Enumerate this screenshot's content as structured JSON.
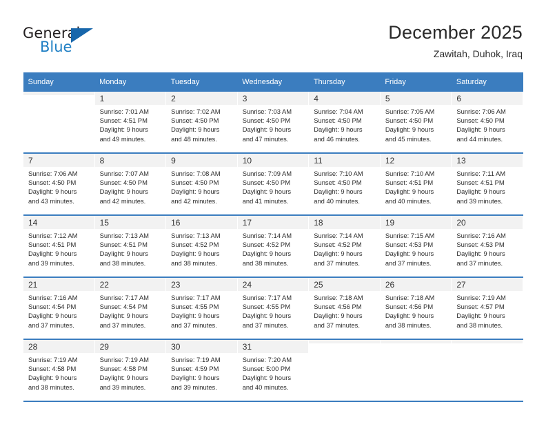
{
  "brand": {
    "name_part1": "General",
    "name_part2": "Blue",
    "triangle_color": "#1766ab",
    "blue_color": "#1f7fc4"
  },
  "header": {
    "title": "December 2025",
    "location": "Zawitah, Duhok, Iraq"
  },
  "theme": {
    "header_row_bg": "#3b7dbf",
    "band_bg": "#f2f2f2",
    "text": "#2b2b2b"
  },
  "calendar": {
    "weekday_headers": [
      "Sunday",
      "Monday",
      "Tuesday",
      "Wednesday",
      "Thursday",
      "Friday",
      "Saturday"
    ],
    "weeks": [
      [
        {
          "day": "",
          "empty": true,
          "sunrise": "",
          "sunset": "",
          "daylight_line1": "",
          "daylight_line2": ""
        },
        {
          "day": "1",
          "sunrise": "Sunrise: 7:01 AM",
          "sunset": "Sunset: 4:51 PM",
          "daylight_line1": "Daylight: 9 hours",
          "daylight_line2": "and 49 minutes."
        },
        {
          "day": "2",
          "sunrise": "Sunrise: 7:02 AM",
          "sunset": "Sunset: 4:50 PM",
          "daylight_line1": "Daylight: 9 hours",
          "daylight_line2": "and 48 minutes."
        },
        {
          "day": "3",
          "sunrise": "Sunrise: 7:03 AM",
          "sunset": "Sunset: 4:50 PM",
          "daylight_line1": "Daylight: 9 hours",
          "daylight_line2": "and 47 minutes."
        },
        {
          "day": "4",
          "sunrise": "Sunrise: 7:04 AM",
          "sunset": "Sunset: 4:50 PM",
          "daylight_line1": "Daylight: 9 hours",
          "daylight_line2": "and 46 minutes."
        },
        {
          "day": "5",
          "sunrise": "Sunrise: 7:05 AM",
          "sunset": "Sunset: 4:50 PM",
          "daylight_line1": "Daylight: 9 hours",
          "daylight_line2": "and 45 minutes."
        },
        {
          "day": "6",
          "sunrise": "Sunrise: 7:06 AM",
          "sunset": "Sunset: 4:50 PM",
          "daylight_line1": "Daylight: 9 hours",
          "daylight_line2": "and 44 minutes."
        }
      ],
      [
        {
          "day": "7",
          "sunrise": "Sunrise: 7:06 AM",
          "sunset": "Sunset: 4:50 PM",
          "daylight_line1": "Daylight: 9 hours",
          "daylight_line2": "and 43 minutes."
        },
        {
          "day": "8",
          "sunrise": "Sunrise: 7:07 AM",
          "sunset": "Sunset: 4:50 PM",
          "daylight_line1": "Daylight: 9 hours",
          "daylight_line2": "and 42 minutes."
        },
        {
          "day": "9",
          "sunrise": "Sunrise: 7:08 AM",
          "sunset": "Sunset: 4:50 PM",
          "daylight_line1": "Daylight: 9 hours",
          "daylight_line2": "and 42 minutes."
        },
        {
          "day": "10",
          "sunrise": "Sunrise: 7:09 AM",
          "sunset": "Sunset: 4:50 PM",
          "daylight_line1": "Daylight: 9 hours",
          "daylight_line2": "and 41 minutes."
        },
        {
          "day": "11",
          "sunrise": "Sunrise: 7:10 AM",
          "sunset": "Sunset: 4:50 PM",
          "daylight_line1": "Daylight: 9 hours",
          "daylight_line2": "and 40 minutes."
        },
        {
          "day": "12",
          "sunrise": "Sunrise: 7:10 AM",
          "sunset": "Sunset: 4:51 PM",
          "daylight_line1": "Daylight: 9 hours",
          "daylight_line2": "and 40 minutes."
        },
        {
          "day": "13",
          "sunrise": "Sunrise: 7:11 AM",
          "sunset": "Sunset: 4:51 PM",
          "daylight_line1": "Daylight: 9 hours",
          "daylight_line2": "and 39 minutes."
        }
      ],
      [
        {
          "day": "14",
          "sunrise": "Sunrise: 7:12 AM",
          "sunset": "Sunset: 4:51 PM",
          "daylight_line1": "Daylight: 9 hours",
          "daylight_line2": "and 39 minutes."
        },
        {
          "day": "15",
          "sunrise": "Sunrise: 7:13 AM",
          "sunset": "Sunset: 4:51 PM",
          "daylight_line1": "Daylight: 9 hours",
          "daylight_line2": "and 38 minutes."
        },
        {
          "day": "16",
          "sunrise": "Sunrise: 7:13 AM",
          "sunset": "Sunset: 4:52 PM",
          "daylight_line1": "Daylight: 9 hours",
          "daylight_line2": "and 38 minutes."
        },
        {
          "day": "17",
          "sunrise": "Sunrise: 7:14 AM",
          "sunset": "Sunset: 4:52 PM",
          "daylight_line1": "Daylight: 9 hours",
          "daylight_line2": "and 38 minutes."
        },
        {
          "day": "18",
          "sunrise": "Sunrise: 7:14 AM",
          "sunset": "Sunset: 4:52 PM",
          "daylight_line1": "Daylight: 9 hours",
          "daylight_line2": "and 37 minutes."
        },
        {
          "day": "19",
          "sunrise": "Sunrise: 7:15 AM",
          "sunset": "Sunset: 4:53 PM",
          "daylight_line1": "Daylight: 9 hours",
          "daylight_line2": "and 37 minutes."
        },
        {
          "day": "20",
          "sunrise": "Sunrise: 7:16 AM",
          "sunset": "Sunset: 4:53 PM",
          "daylight_line1": "Daylight: 9 hours",
          "daylight_line2": "and 37 minutes."
        }
      ],
      [
        {
          "day": "21",
          "sunrise": "Sunrise: 7:16 AM",
          "sunset": "Sunset: 4:54 PM",
          "daylight_line1": "Daylight: 9 hours",
          "daylight_line2": "and 37 minutes."
        },
        {
          "day": "22",
          "sunrise": "Sunrise: 7:17 AM",
          "sunset": "Sunset: 4:54 PM",
          "daylight_line1": "Daylight: 9 hours",
          "daylight_line2": "and 37 minutes."
        },
        {
          "day": "23",
          "sunrise": "Sunrise: 7:17 AM",
          "sunset": "Sunset: 4:55 PM",
          "daylight_line1": "Daylight: 9 hours",
          "daylight_line2": "and 37 minutes."
        },
        {
          "day": "24",
          "sunrise": "Sunrise: 7:17 AM",
          "sunset": "Sunset: 4:55 PM",
          "daylight_line1": "Daylight: 9 hours",
          "daylight_line2": "and 37 minutes."
        },
        {
          "day": "25",
          "sunrise": "Sunrise: 7:18 AM",
          "sunset": "Sunset: 4:56 PM",
          "daylight_line1": "Daylight: 9 hours",
          "daylight_line2": "and 37 minutes."
        },
        {
          "day": "26",
          "sunrise": "Sunrise: 7:18 AM",
          "sunset": "Sunset: 4:56 PM",
          "daylight_line1": "Daylight: 9 hours",
          "daylight_line2": "and 38 minutes."
        },
        {
          "day": "27",
          "sunrise": "Sunrise: 7:19 AM",
          "sunset": "Sunset: 4:57 PM",
          "daylight_line1": "Daylight: 9 hours",
          "daylight_line2": "and 38 minutes."
        }
      ],
      [
        {
          "day": "28",
          "sunrise": "Sunrise: 7:19 AM",
          "sunset": "Sunset: 4:58 PM",
          "daylight_line1": "Daylight: 9 hours",
          "daylight_line2": "and 38 minutes."
        },
        {
          "day": "29",
          "sunrise": "Sunrise: 7:19 AM",
          "sunset": "Sunset: 4:58 PM",
          "daylight_line1": "Daylight: 9 hours",
          "daylight_line2": "and 39 minutes."
        },
        {
          "day": "30",
          "sunrise": "Sunrise: 7:19 AM",
          "sunset": "Sunset: 4:59 PM",
          "daylight_line1": "Daylight: 9 hours",
          "daylight_line2": "and 39 minutes."
        },
        {
          "day": "31",
          "sunrise": "Sunrise: 7:20 AM",
          "sunset": "Sunset: 5:00 PM",
          "daylight_line1": "Daylight: 9 hours",
          "daylight_line2": "and 40 minutes."
        },
        {
          "day": "",
          "empty": true,
          "sunrise": "",
          "sunset": "",
          "daylight_line1": "",
          "daylight_line2": ""
        },
        {
          "day": "",
          "empty": true,
          "sunrise": "",
          "sunset": "",
          "daylight_line1": "",
          "daylight_line2": ""
        },
        {
          "day": "",
          "empty": true,
          "sunrise": "",
          "sunset": "",
          "daylight_line1": "",
          "daylight_line2": ""
        }
      ]
    ]
  }
}
